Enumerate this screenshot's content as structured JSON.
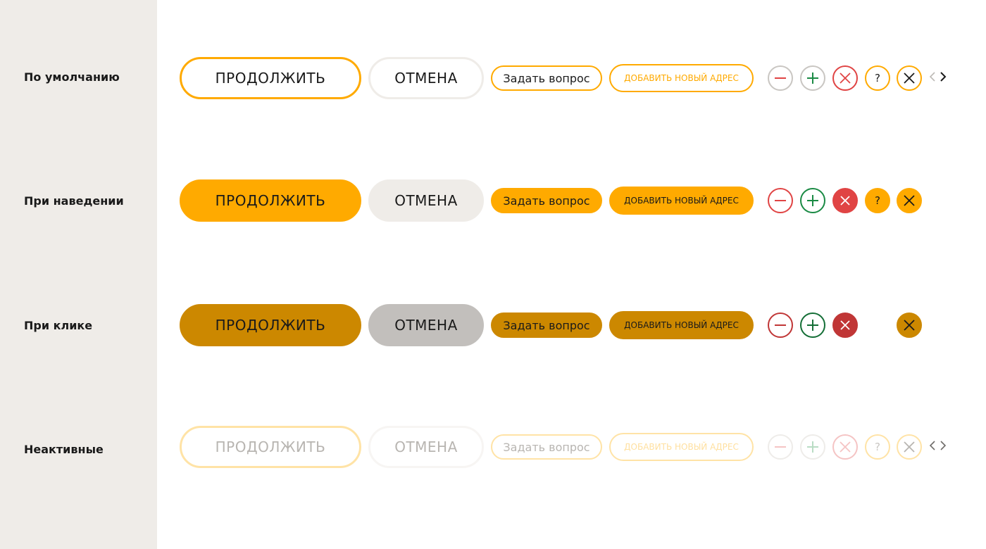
{
  "states": [
    {
      "key": "default",
      "label": "По умолчанию"
    },
    {
      "key": "hover",
      "label": "При наведении"
    },
    {
      "key": "active",
      "label": "При клике"
    },
    {
      "key": "disabled",
      "label": "Неактивные"
    }
  ],
  "buttons": {
    "continue_label": "ПРОДОЛЖИТЬ",
    "cancel_label": "ОТМЕНА",
    "ask_label": "Задать вопрос",
    "add_address_label": "ДОБАВИТЬ НОВЫЙ АДРЕС"
  },
  "icons": {
    "minus": "minus-icon",
    "plus": "plus-icon",
    "close_red": "close-icon",
    "help": "question-icon",
    "close_orange": "close-icon",
    "prev": "chevron-left-icon",
    "next": "chevron-right-icon"
  },
  "colors": {
    "accent": "#ffaa00",
    "accent_pressed": "#cc8800",
    "neutral_hover": "#efece8",
    "neutral_pressed": "#c2bfbc",
    "danger": "#e04444",
    "danger_pressed": "#c03636",
    "success": "#1a8a44",
    "text": "#1a1a1a"
  }
}
